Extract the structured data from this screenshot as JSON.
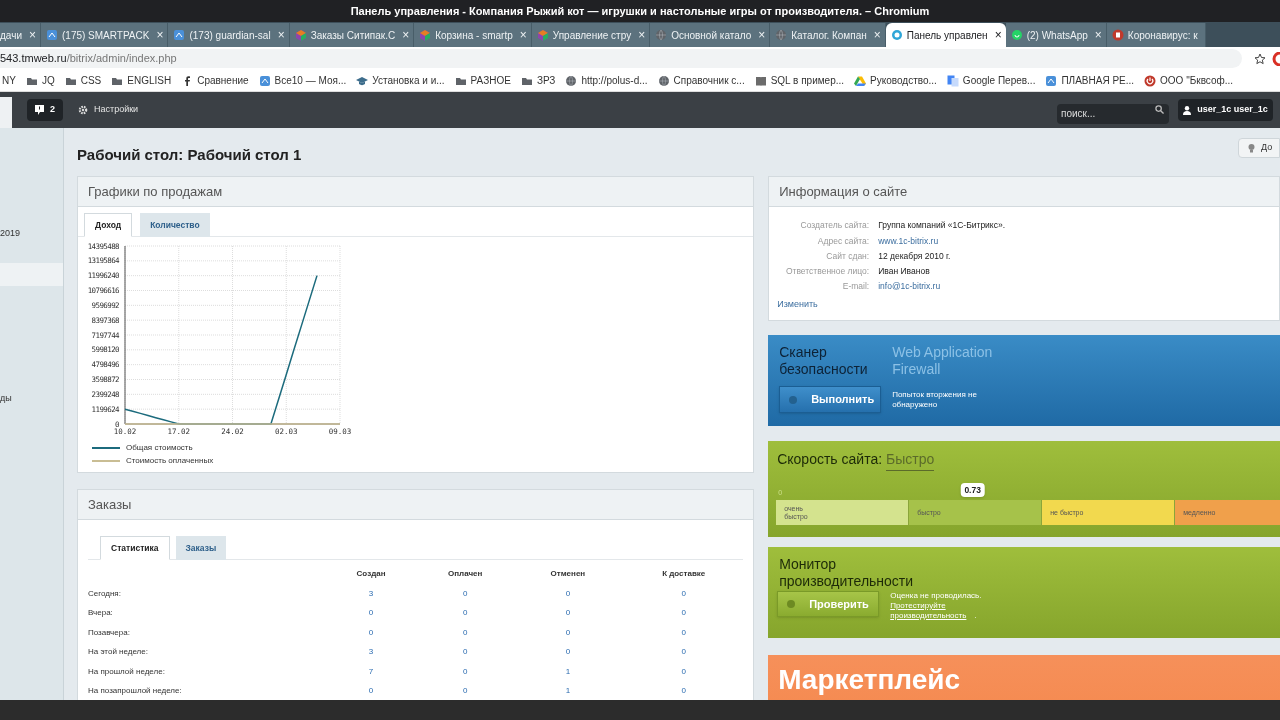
{
  "window": {
    "title": "Панель управления - Компания Рыжий кот — игрушки и настольные игры от производителя. – Chromium"
  },
  "tabs": [
    {
      "label": "дачи",
      "kind": "none",
      "close": "×",
      "selected": false
    },
    {
      "label": "(175) SMARTPACK",
      "kind": "site",
      "close": "×",
      "selected": false
    },
    {
      "label": "(173) guardian-sal",
      "kind": "site",
      "close": "×",
      "selected": false
    },
    {
      "label": "Заказы Ситипак.С",
      "kind": "cube",
      "close": "×",
      "selected": false
    },
    {
      "label": "Корзина - smartp",
      "kind": "cube",
      "close": "×",
      "selected": false
    },
    {
      "label": "Управление стру",
      "kind": "cube",
      "close": "×",
      "selected": false
    },
    {
      "label": "Основной катало",
      "kind": "globe",
      "close": "×",
      "selected": false
    },
    {
      "label": "Каталог. Компан",
      "kind": "globe",
      "close": "×",
      "selected": false
    },
    {
      "label": "Панель управлен",
      "kind": "bitrix",
      "close": "×",
      "selected": true
    },
    {
      "label": "(2) WhatsApp",
      "kind": "chat",
      "close": "×",
      "selected": false
    },
    {
      "label": "Коронавирус: к",
      "kind": "news",
      "selected": false
    }
  ],
  "address_bar": {
    "host": "543.tmweb.ru",
    "path": "/bitrix/admin/index.php"
  },
  "bookmarks": [
    {
      "label": "NY",
      "kind": "none"
    },
    {
      "label": "JQ",
      "kind": "folder"
    },
    {
      "label": "CSS",
      "kind": "folder"
    },
    {
      "label": "ENGLISH",
      "kind": "folder"
    },
    {
      "label": "Сравнение",
      "kind": "facebook"
    },
    {
      "label": "Все10 — Моя...",
      "kind": "site"
    },
    {
      "label": "Установка и и...",
      "kind": "cap"
    },
    {
      "label": "РАЗНОЕ",
      "kind": "folder"
    },
    {
      "label": "ЗРЗ",
      "kind": "folder"
    },
    {
      "label": "http://polus-d...",
      "kind": "globe"
    },
    {
      "label": "Справочник с...",
      "kind": "globe"
    },
    {
      "label": "SQL в пример...",
      "kind": "book"
    },
    {
      "label": "Руководство...",
      "kind": "cloud"
    },
    {
      "label": "Google Перев...",
      "kind": "translate"
    },
    {
      "label": "ПЛАВНАЯ РЕ...",
      "kind": "site"
    },
    {
      "label": "ООО \"Бквсоф...",
      "kind": "power"
    }
  ],
  "admin_bar": {
    "notifications": "2",
    "settings": "Настройки",
    "search_placeholder": "поиск...",
    "user": "user_1c user_1c"
  },
  "sidebar": {
    "items": [
      {
        "label": "2019",
        "selected": false
      },
      {
        "selected": true
      },
      {
        "label": "ды",
        "selected": false
      }
    ]
  },
  "page_title": "Рабочий стол: Рабочий стол 1",
  "top_right_button": "До",
  "sales_panel": {
    "title": "Графики по продажам",
    "tabs": [
      {
        "label": "Доход",
        "selected": true
      },
      {
        "label": "Количество",
        "selected": false
      }
    ],
    "chart_data": {
      "type": "line",
      "categories": [
        "10.02",
        null,
        null,
        null,
        null,
        null,
        null,
        "17.02",
        null,
        null,
        null,
        null,
        null,
        null,
        "24.02",
        null,
        null,
        null,
        null,
        null,
        null,
        "02.03",
        null,
        null,
        null,
        null,
        null,
        null,
        "09.03"
      ],
      "series": [
        {
          "name": "Общая стоимость",
          "color": "#1c6b7d",
          "values": [
            1200000,
            1030000,
            860000,
            690000,
            510000,
            340000,
            170000,
            0,
            0,
            0,
            0,
            0,
            0,
            0,
            0,
            0,
            0,
            0,
            0,
            0,
            2000000,
            4000000,
            6000000,
            8000000,
            10000000,
            12000000,
            null,
            null,
            null
          ]
        },
        {
          "name": "Стоимость оплаченных",
          "color": "#c9bd94",
          "values": [
            0,
            0,
            0,
            0,
            0,
            0,
            0,
            0,
            0,
            0,
            0,
            0,
            0,
            0,
            0,
            0,
            0,
            0,
            0,
            0,
            0,
            0,
            0,
            0,
            0,
            0,
            0,
            0,
            0
          ]
        }
      ],
      "ylim": [
        0,
        14395488
      ],
      "grid": true,
      "yticks": [
        0,
        1199624,
        2399248,
        3598872,
        4798496,
        5998120,
        7197744,
        8397368,
        9596992,
        10796616,
        11996240,
        13195864,
        14395488
      ]
    }
  },
  "orders_panel": {
    "title": "Заказы",
    "tabs": [
      {
        "label": "Статистика",
        "selected": true
      },
      {
        "label": "Заказы",
        "selected": false
      }
    ],
    "columns": [
      "Создан",
      "Оплачен",
      "Отменен",
      "К доставке"
    ],
    "rows": [
      {
        "label": "Сегодня:",
        "values": [
          "3",
          "0",
          "0",
          "0"
        ]
      },
      {
        "label": "Вчера:",
        "values": [
          "0",
          "0",
          "0",
          "0"
        ]
      },
      {
        "label": "Позавчера:",
        "values": [
          "0",
          "0",
          "0",
          "0"
        ]
      },
      {
        "label": "На этой неделе:",
        "values": [
          "3",
          "0",
          "0",
          "0"
        ]
      },
      {
        "label": "На прошлой неделе:",
        "values": [
          "7",
          "0",
          "1",
          "0"
        ]
      },
      {
        "label": "На позапрошлой неделе:",
        "values": [
          "0",
          "0",
          "1",
          "0"
        ]
      }
    ]
  },
  "site_info": {
    "title": "Информация о сайте",
    "rows": [
      {
        "label": "Создатель сайта:",
        "value": "Группа компаний «1С-Битрикс».",
        "kind": "text"
      },
      {
        "label": "Адрес сайта:",
        "value": "www.1c-bitrix.ru",
        "kind": "link"
      },
      {
        "label": "Сайт сдан:",
        "value": "12 декабря 2010 г.",
        "kind": "text"
      },
      {
        "label": "Ответственное лицо:",
        "value": "Иван Иванов",
        "kind": "text"
      },
      {
        "label": "E-mail:",
        "value": "info@1c-bitrix.ru",
        "kind": "link"
      }
    ],
    "edit_link": "Изменить"
  },
  "security_scanner": {
    "title": "Сканер безопасности",
    "subtitle": "Web Application Firewall",
    "button": "Выполнить",
    "status": "Попыток вторжения не обнаружено"
  },
  "site_speed": {
    "title": "Скорость сайта:",
    "value": "Быстро",
    "scale_start": "0",
    "reading": "0.73",
    "level": 0.39,
    "segments": [
      {
        "label": "очень быстро",
        "color": "#d4e38e"
      },
      {
        "label": "быстро",
        "color": "#a6c24a"
      },
      {
        "label": "не быстро",
        "color": "#f2d94e"
      },
      {
        "label": "медленно",
        "color": "#f0a04b"
      }
    ]
  },
  "performance_monitor": {
    "title": "Монитор производительности",
    "button": "Проверить",
    "status": "Оценка не проводилась.",
    "link": "Протестируйте производительность",
    "link_suffix": "."
  },
  "marketplace": {
    "title": "Маркетплейс"
  }
}
